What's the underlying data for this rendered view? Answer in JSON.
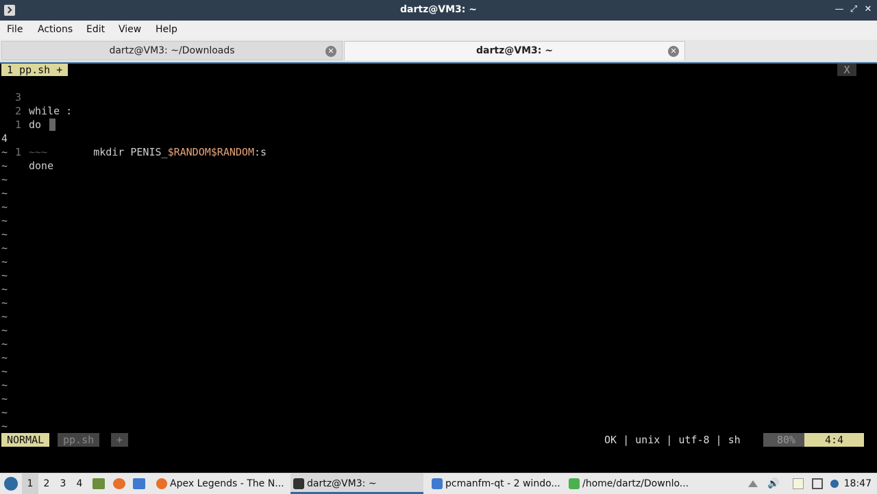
{
  "window": {
    "title": "dartz@VM3: ~"
  },
  "menu": [
    "File",
    "Actions",
    "Edit",
    "View",
    "Help"
  ],
  "tabs": [
    {
      "label": "dartz@VM3: ~/Downloads"
    },
    {
      "label": "dartz@VM3: ~"
    }
  ],
  "vim": {
    "tab_label": "1  pp.sh  +",
    "close_label": "X",
    "lines": [
      {
        "num": "3",
        "text": "while :"
      },
      {
        "num": "2",
        "text": "do"
      },
      {
        "num": "1",
        "prefix": "mkdir PENIS_",
        "var": "$RANDOM$RANDOM",
        "suffix": ":s"
      },
      {
        "num": "4",
        "text": "~~~"
      },
      {
        "num": "1",
        "text": "done"
      }
    ],
    "tilde": "~",
    "status": {
      "mode": "NORMAL",
      "file": "pp.sh",
      "modified": "+",
      "info": "OK | unix | utf-8 | sh",
      "percent": "80%",
      "position": "4:4"
    }
  },
  "taskbar": {
    "workspaces": [
      "1",
      "2",
      "3",
      "4"
    ],
    "tasks": [
      {
        "label": "Apex Legends - The N..."
      },
      {
        "label": "dartz@VM3: ~"
      },
      {
        "label": "pcmanfm-qt - 2 windo..."
      },
      {
        "label": "/home/dartz/Downlo..."
      }
    ],
    "clock": "18:47"
  },
  "colors": {
    "accent": "#2f6aa0",
    "vim_yellow": "#dcd89c",
    "titlebar": "#2e3e4e"
  }
}
